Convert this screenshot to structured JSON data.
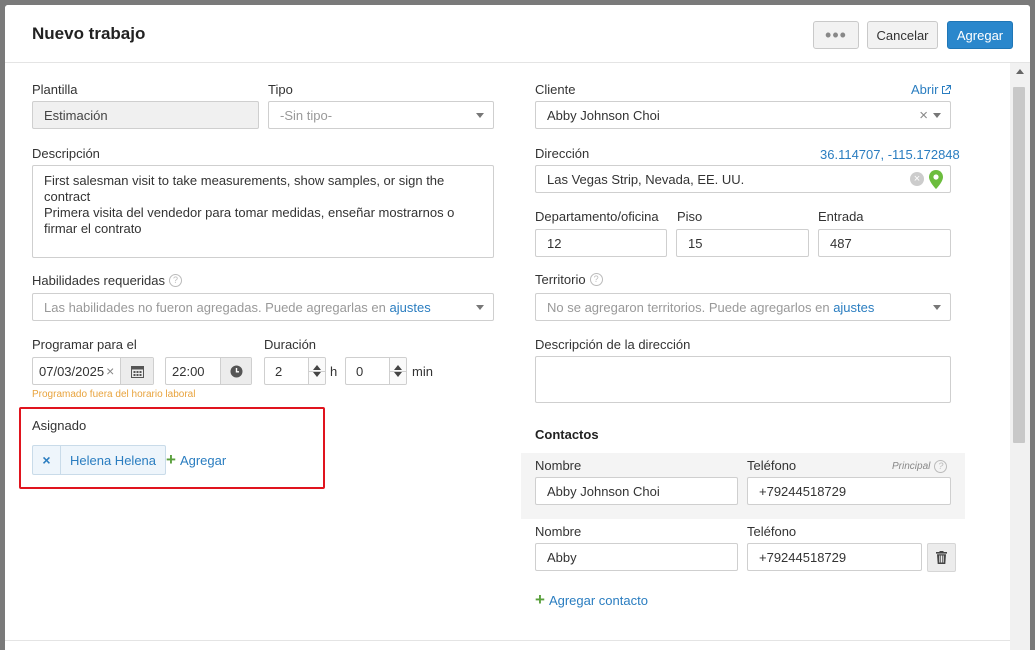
{
  "header": {
    "title": "Nuevo trabajo",
    "more_label": "•••",
    "cancel_label": "Cancelar",
    "add_label": "Agregar"
  },
  "left": {
    "plantilla_label": "Plantilla",
    "plantilla_value": "Estimación",
    "tipo_label": "Tipo",
    "tipo_value": "-Sin tipo-",
    "descripcion_label": "Descripción",
    "descripcion_value": "First salesman visit to take measurements, show samples, or sign the contract\nPrimera visita del vendedor para tomar medidas, enseñar mostrarnos o firmar el contrato",
    "habilidades_label": "Habilidades requeridas",
    "habilidades_text": "Las habilidades no fueron agregadas. Puede agregarlas en",
    "habilidades_link": "ajustes",
    "programar_label": "Programar para el",
    "fecha_value": "07/03/2025",
    "hora_value": "22:00",
    "duracion_label": "Duración",
    "horas_value": "2",
    "horas_unit": "h",
    "minutos_value": "0",
    "minutos_unit": "min",
    "warning": "Programado fuera del horario laboral",
    "asignado_label": "Asignado",
    "assignee_name": "Helena Helena",
    "assignee_remove": "×",
    "add_assignee_label": "Agregar"
  },
  "right": {
    "cliente_label": "Cliente",
    "abrir_label": "Abrir",
    "cliente_value": "Abby Johnson Choi",
    "clear_symbol": "×",
    "direccion_label": "Dirección",
    "coords": "36.114707, -115.172848",
    "direccion_value": "Las Vegas Strip, Nevada, EE. UU.",
    "depto_label": "Departamento/oficina",
    "depto_value": "12",
    "piso_label": "Piso",
    "piso_value": "15",
    "entrada_label": "Entrada",
    "entrada_value": "487",
    "territorio_label": "Territorio",
    "territorio_text": "No se agregaron territorios. Puede agregarlos en",
    "territorio_link": "ajustes",
    "desc_dir_label": "Descripción de la dirección",
    "contactos_title": "Contactos",
    "contacts": [
      {
        "nombre_label": "Nombre",
        "telefono_label": "Teléfono",
        "principal_label": "Principal",
        "nombre": "Abby Johnson Choi",
        "telefono": "+79244518729"
      },
      {
        "nombre_label": "Nombre",
        "telefono_label": "Teléfono",
        "nombre": "Abby",
        "telefono": "+79244518729"
      }
    ],
    "add_contact_label": "Agregar contacto"
  },
  "colors": {
    "primary": "#2a87cc",
    "link": "#2a7dc0",
    "warning": "#e8a33d",
    "highlight": "#e0141e",
    "pin": "#6cbd3e"
  }
}
